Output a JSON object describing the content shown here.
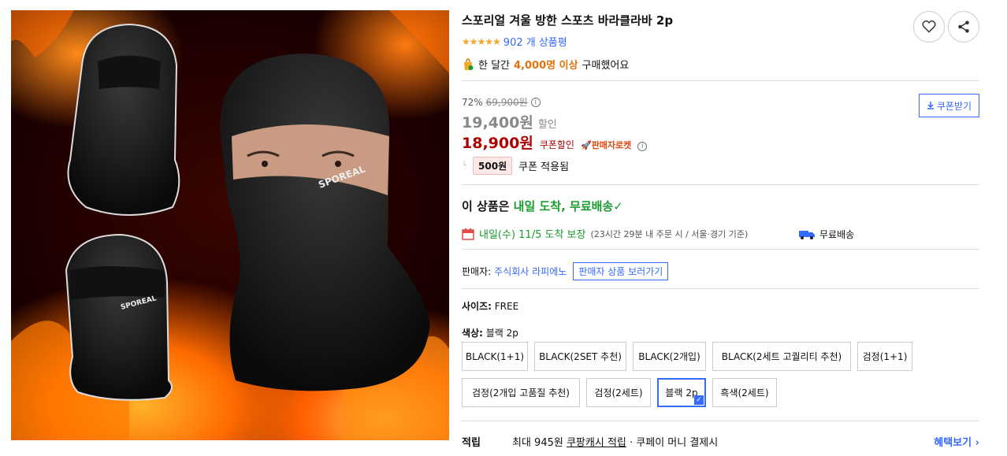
{
  "product": {
    "title": "스포리얼 겨울 방한 스포츠 바라클라바 2p",
    "image_brand_text": "SPOREAL"
  },
  "rating": {
    "stars": "★★★★★",
    "review_count_label": "902 개 상품평"
  },
  "purchase_stat": {
    "prefix": "한 달간",
    "count": "4,000명 이상",
    "suffix": "구매했어요"
  },
  "pricing": {
    "discount_rate": "72%",
    "original_price": "69,900원",
    "sale_price": "19,400원",
    "sale_label": "할인",
    "coupon_price": "18,900원",
    "coupon_label": "쿠폰할인",
    "rocket_label": "판매자로켓",
    "coupon_amount": "500원",
    "coupon_applied_label": "쿠폰 적용됨",
    "coupon_button": "쿠폰받기"
  },
  "delivery": {
    "headline_prefix": "이 상품은",
    "headline_green": "내일 도착, 무료배송",
    "eta_green": "내일(수) 11/5 도착 보장",
    "eta_note": "(23시간 29분 내 주문 시 / 서울·경기 기준)",
    "free_shipping": "무료배송"
  },
  "seller": {
    "label": "판매자:",
    "name": "주식회사 라피에노",
    "button": "판매자 상품 보러가기"
  },
  "options": {
    "size_label": "사이즈:",
    "size_value": "FREE",
    "color_label": "색상:",
    "color_value": "블랙 2p",
    "colors": [
      "BLACK(1+1)",
      "BLACK(2SET 추천)",
      "BLACK(2개입)",
      "BLACK(2세트 고퀄리티 추천)",
      "검정(1+1)",
      "검정(2개입 고품질 추천)",
      "검정(2세트)",
      "블랙 2p",
      "흑색(2세트)"
    ],
    "selected_color": "블랙 2p",
    "check_mark": "✓"
  },
  "reward": {
    "label": "적립",
    "text_prefix": "최대 945원",
    "link": "쿠팡캐시 적립",
    "text_suffix": "· 쿠페이 머니 결제시",
    "more": "혜택보기 ›"
  },
  "colors": {
    "accent_blue": "#346aff",
    "price_red": "#ae0000",
    "green": "#1a9c2f",
    "orange": "#e0720f"
  },
  "icons": {
    "heart": "heart-icon",
    "share": "share-icon",
    "calendar": "calendar-icon",
    "truck": "truck-icon",
    "download": "download-icon",
    "info": "info-icon",
    "bag": "shopping-bag-icon"
  }
}
